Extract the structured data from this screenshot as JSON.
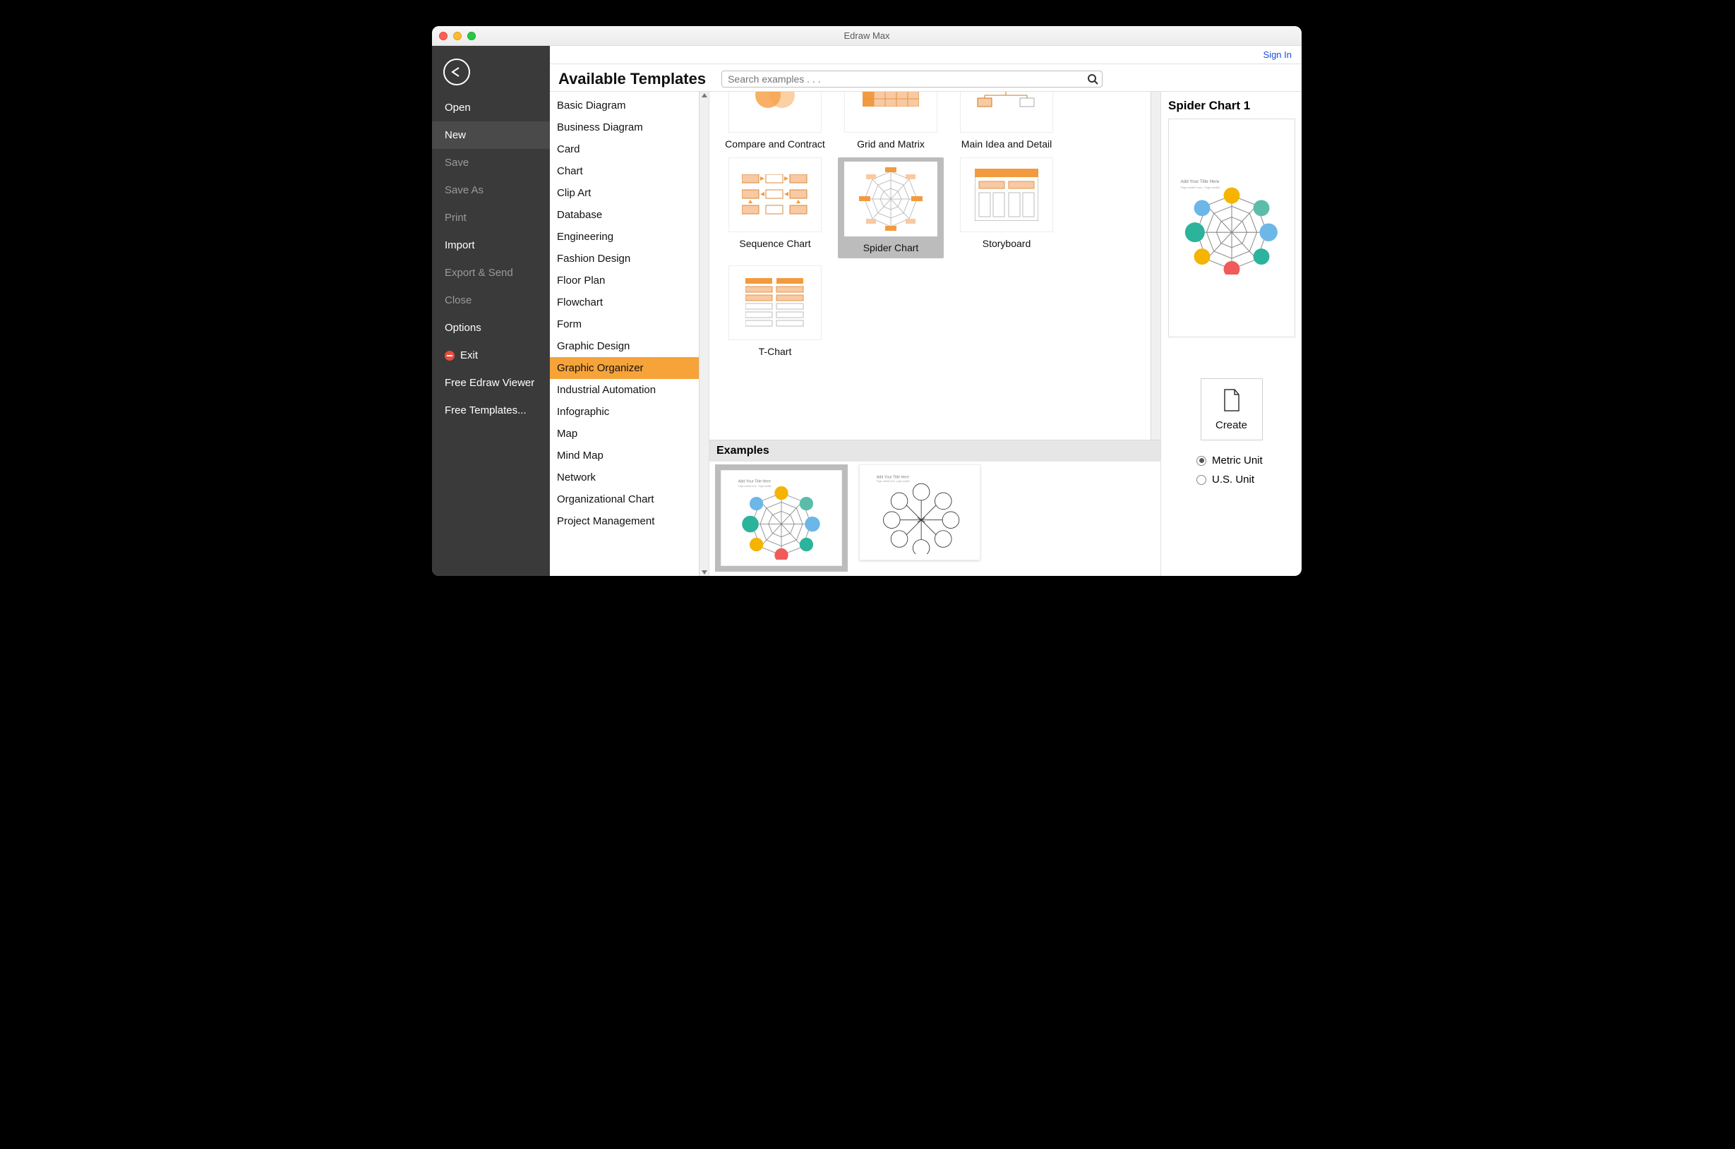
{
  "window": {
    "title": "Edraw Max"
  },
  "signin": "Sign In",
  "sidebar": {
    "items": [
      {
        "label": "Open",
        "dim": false
      },
      {
        "label": "New",
        "dim": false,
        "selected": true
      },
      {
        "label": "Save",
        "dim": true
      },
      {
        "label": "Save As",
        "dim": true
      },
      {
        "label": "Print",
        "dim": true
      },
      {
        "label": "Import",
        "dim": false
      },
      {
        "label": "Export & Send",
        "dim": true
      },
      {
        "label": "Close",
        "dim": true
      },
      {
        "label": "Options",
        "dim": false
      },
      {
        "label": "Exit",
        "dim": false,
        "icon": "exit"
      },
      {
        "label": "Free Edraw Viewer",
        "dim": false
      },
      {
        "label": "Free Templates...",
        "dim": false
      }
    ]
  },
  "header": {
    "title": "Available Templates",
    "search_placeholder": "Search examples . . ."
  },
  "categories": [
    "Basic Diagram",
    "Business Diagram",
    "Card",
    "Chart",
    "Clip Art",
    "Database",
    "Engineering",
    "Fashion Design",
    "Floor Plan",
    "Flowchart",
    "Form",
    "Graphic Design",
    "Graphic Organizer",
    "Industrial Automation",
    "Infographic",
    "Map",
    "Mind Map",
    "Network",
    "Organizational Chart",
    "Project Management"
  ],
  "categories_selected_index": 12,
  "templates": [
    {
      "label": "Compare and Contract",
      "half": true,
      "kind": "venn"
    },
    {
      "label": "Grid and Matrix",
      "half": true,
      "kind": "grid"
    },
    {
      "label": "Main Idea and Detail",
      "half": true,
      "kind": "mainidea"
    },
    {
      "label": "Sequence Chart",
      "kind": "sequence"
    },
    {
      "label": "Spider Chart",
      "kind": "spider",
      "selected": true
    },
    {
      "label": "Storyboard",
      "kind": "storyboard"
    },
    {
      "label": "T-Chart",
      "kind": "tchart"
    }
  ],
  "examples_header": "Examples",
  "examples": [
    {
      "kind": "spider-color",
      "selected": true
    },
    {
      "kind": "spider-outline"
    }
  ],
  "right": {
    "title": "Spider Chart 1",
    "create_label": "Create",
    "units": [
      {
        "label": "Metric Unit",
        "selected": true
      },
      {
        "label": "U.S. Unit",
        "selected": false
      }
    ]
  }
}
